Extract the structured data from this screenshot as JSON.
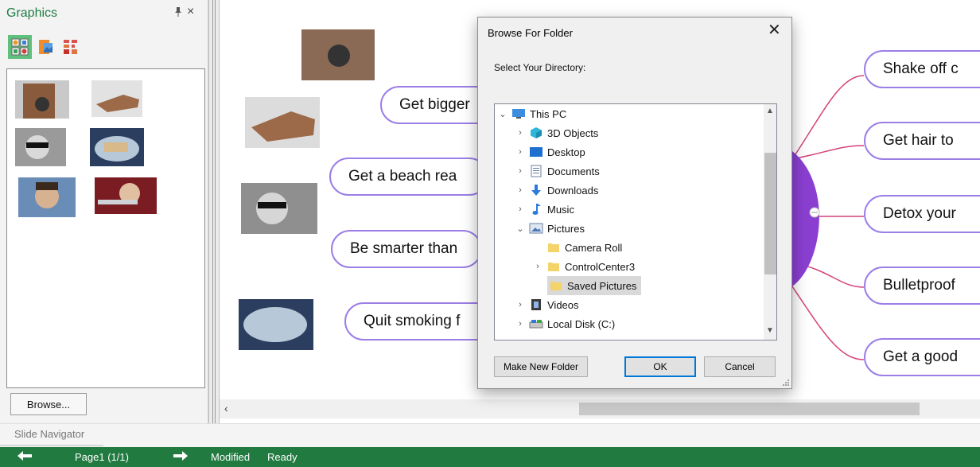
{
  "graphics_panel": {
    "title": "Graphics",
    "pin_glyph": "ᵽ",
    "close_glyph": "×",
    "tabs": [
      {
        "icon": "clipart-icon",
        "active": true
      },
      {
        "icon": "image-file-icon",
        "active": false
      },
      {
        "icon": "icon-set-icon",
        "active": false
      }
    ],
    "browse_label": "Browse..."
  },
  "canvas": {
    "topics_left": [
      "Get bigger",
      "Get a beach rea",
      "Be smarter than",
      "Quit smoking f"
    ],
    "topics_right": [
      "Shake off c",
      "Get hair to",
      "Detox your",
      "Bulletproof",
      "Get a good"
    ],
    "line_color": "#d4427a",
    "border_color": "#9b7ee6",
    "center_color": "#8a3fd1",
    "scroll_left_glyph": "‹"
  },
  "dialog": {
    "title": "Browse For Folder",
    "close_glyph": "✕",
    "prompt": "Select Your Directory:",
    "tree": [
      {
        "label": "This PC",
        "icon": "computer-icon",
        "toggle": "⌄",
        "level": 0
      },
      {
        "label": "3D Objects",
        "icon": "cube-icon",
        "toggle": "›",
        "level": 1
      },
      {
        "label": "Desktop",
        "icon": "desktop-icon",
        "toggle": "›",
        "level": 1
      },
      {
        "label": "Documents",
        "icon": "document-icon",
        "toggle": "›",
        "level": 1
      },
      {
        "label": "Downloads",
        "icon": "download-icon",
        "toggle": "›",
        "level": 1
      },
      {
        "label": "Music",
        "icon": "music-icon",
        "toggle": "›",
        "level": 1
      },
      {
        "label": "Pictures",
        "icon": "pictures-icon",
        "toggle": "⌄",
        "level": 1
      },
      {
        "label": "Camera Roll",
        "icon": "folder-icon",
        "toggle": "",
        "level": 2
      },
      {
        "label": "ControlCenter3",
        "icon": "folder-icon",
        "toggle": "›",
        "level": 2
      },
      {
        "label": "Saved Pictures",
        "icon": "folder-icon",
        "toggle": "",
        "level": 2,
        "selected": true
      },
      {
        "label": "Videos",
        "icon": "video-icon",
        "toggle": "›",
        "level": 1
      },
      {
        "label": "Local Disk (C:)",
        "icon": "disk-icon",
        "toggle": "›",
        "level": 1
      }
    ],
    "buttons": {
      "new_folder": "Make New Folder",
      "ok": "OK",
      "cancel": "Cancel"
    }
  },
  "slide_navigator": {
    "label": "Slide Navigator"
  },
  "status": {
    "page": "Page1 (1/1)",
    "modified": "Modified",
    "ready": "Ready",
    "bg_color": "#217a3f"
  }
}
